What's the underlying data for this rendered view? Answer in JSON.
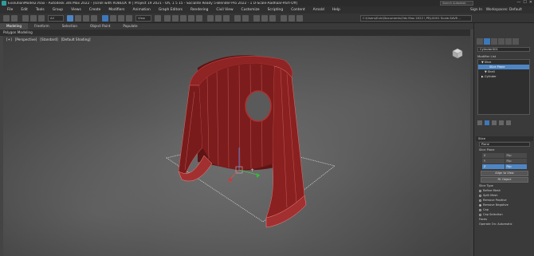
{
  "window": {
    "title": "EvolutionModel2.max - Autodesk 3ds Max 2022 - [scroll with ROBLOX ® | Project 19 2021 - Oh, 1 5 15 - Socialite Ready 5-Blender-Pro 2022 - 1 D-Scale-Aadhaar-Part-Off]",
    "search_placeholder": "Search Autodesk",
    "minimize": "—",
    "maximize": "☐",
    "close": "✕"
  },
  "menu": {
    "items": [
      "File",
      "Edit",
      "Tools",
      "Group",
      "Views",
      "Create",
      "Modifiers",
      "Animation",
      "Graph Editors",
      "Rendering",
      "Civil View",
      "Customize",
      "Scripting",
      "Content",
      "Civil View",
      "Arnold",
      "Help"
    ],
    "user": "Sign In",
    "workspace": "Workspaces: Default"
  },
  "toolbar": {
    "filter_label": "All",
    "view_label": "View",
    "project_path": "C:\\Users\\Eulc\\Documents\\3ds Max 2022 \\ PRJ-0001 Scale-SAVE..."
  },
  "ribbon": {
    "tabs": [
      "Modeling",
      "Freeform",
      "Selection",
      "Object Paint",
      "Populate"
    ],
    "active_tab": "Modeling",
    "subtitle": "Polygon Modeling"
  },
  "viewport": {
    "labels": [
      "[+]",
      "[Perspective]",
      "[Standard]",
      "[Default Shading]"
    ]
  },
  "command_panel": {
    "object_name": "Cylinder001",
    "modifier_list_label": "Modifier List",
    "stack": [
      {
        "label": "▼ Slice",
        "type": "normal"
      },
      {
        "label": "Slice Plane",
        "type": "sel"
      },
      {
        "label": "▼ Shell",
        "type": "sub"
      },
      {
        "label": "▶ Cylinder",
        "type": "normal"
      }
    ],
    "rollout_title": "Slice",
    "slice_with_label": "Plane",
    "slice_plane_label": "Slice Plane",
    "axis_buttons": [
      "X",
      "Flip",
      "Y",
      "Flip",
      "Z",
      "Flip"
    ],
    "active_axis": "Z",
    "align_button": "Align to View",
    "fit_button": "Fit Object",
    "slice_type_label": "Slice Type",
    "slice_types": [
      "Refine Mesh",
      "Split Mesh",
      "Remove Positive",
      "Remove Negative"
    ],
    "active_slice_type": "Remove Negative",
    "cap_label": "Cap",
    "cap_option": "Cap Selection",
    "faces_label": "Faces",
    "operate_label": "Operate On:",
    "operate_value": "Automatic"
  }
}
